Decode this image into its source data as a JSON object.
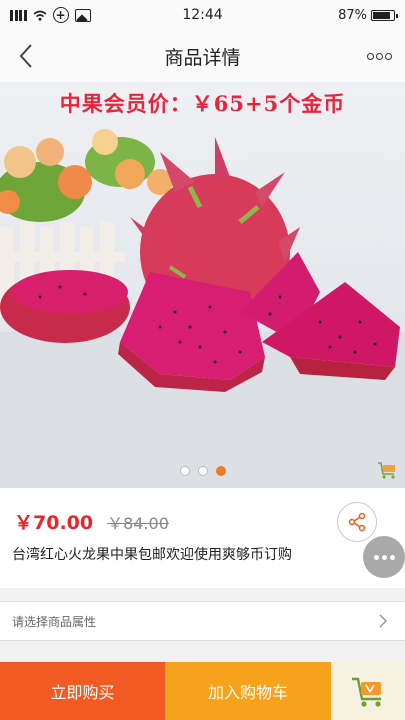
{
  "status_bar": {
    "time": "12:44",
    "battery_text": "87%",
    "battery_level": 0.87,
    "icons": [
      "signal-icon",
      "wifi-icon",
      "add-circle-icon",
      "image-icon",
      "battery-icon"
    ]
  },
  "nav": {
    "title": "商品详情",
    "back_icon": "back-arrow-icon",
    "more_icon": "more-icon"
  },
  "gallery": {
    "promo_text": "中果会员价：￥65+5个金币",
    "slide_count": 3,
    "active_slide": 3,
    "image_subject": "dragon-fruit-image",
    "badge_icon": "shopping-cart-logo-icon"
  },
  "product": {
    "price": "￥70.00",
    "original_price": "￥84.00",
    "name": "台湾红心火龙果中果包邮欢迎使用爽够币订购",
    "share_icon": "share-icon"
  },
  "attributes": {
    "label": "请选择商品属性",
    "icon": "chevron-right-icon"
  },
  "actions": {
    "buy_now": "立即购买",
    "add_to_cart": "加入购物车",
    "cart_icon": "shopping-cart-logo-icon"
  },
  "colors": {
    "price_red": "#e8262c",
    "buy_now_orange": "#f15a22",
    "add_cart_orange": "#f7a21b",
    "active_dot": "#f07b27"
  }
}
